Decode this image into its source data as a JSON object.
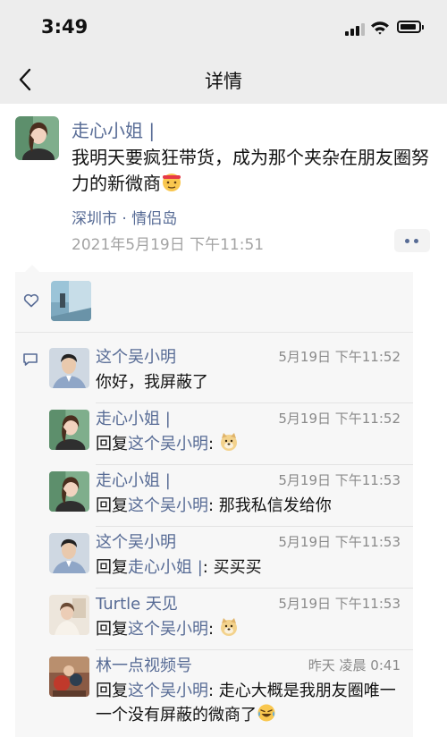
{
  "status_bar": {
    "time": "3:49"
  },
  "nav": {
    "title": "详情"
  },
  "post": {
    "author": "走心小姐 |",
    "text": "我明天要疯狂带货，成为那个夹杂在朋友圈努力的新微商",
    "location": "深圳市 · 情侣岛",
    "timestamp": "2021年5月19日 下午11:51"
  },
  "comments": [
    {
      "author": "这个吴小明",
      "time": "5月19日 下午11:52",
      "text": "你好，我屏蔽了"
    },
    {
      "author": "走心小姐 |",
      "time": "5月19日 下午11:52",
      "reply_prefix": "回复",
      "reply_to": "这个吴小明",
      "text": ": "
    },
    {
      "author": "走心小姐 |",
      "time": "5月19日 下午11:53",
      "reply_prefix": "回复",
      "reply_to": "这个吴小明",
      "text": ": 那我私信发给你"
    },
    {
      "author": "这个吴小明",
      "time": "5月19日 下午11:53",
      "reply_prefix": "回复",
      "reply_to": "走心小姐 |",
      "text": ": 买买买"
    },
    {
      "author": "Turtle 天见",
      "time": "5月19日 下午11:53",
      "reply_prefix": "回复",
      "reply_to": "这个吴小明",
      "text": ": "
    },
    {
      "author": "林一点视频号",
      "time": "昨天 凌晨 0:41",
      "reply_prefix": "回复",
      "reply_to": "这个吴小明",
      "text": ": 走心大概是我朋友圈唯一一个没有屏蔽的微商了"
    }
  ],
  "icons": {
    "back": "chevron-left-icon",
    "more": "more-dots-icon",
    "like": "heart-outline-icon",
    "comment": "comment-bubble-icon"
  },
  "colors": {
    "link": "#576b95",
    "bar_bg": "#ededed",
    "panel_bg": "#f7f7f7"
  }
}
